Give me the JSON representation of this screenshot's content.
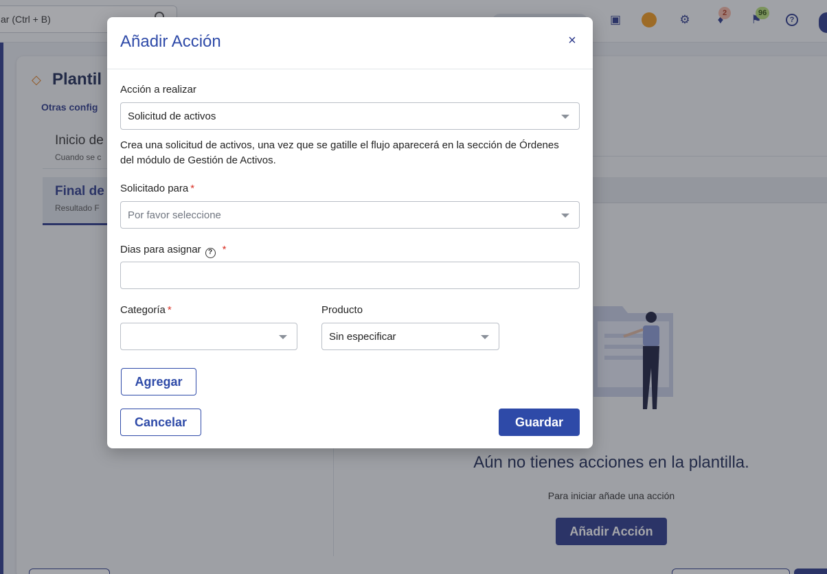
{
  "topbar": {
    "search_text": "ar (Ctrl + B)",
    "notifications_count": "2",
    "announcements_count": "96"
  },
  "background": {
    "page_title": "Plantil",
    "subnav": "Otras config",
    "stage1_title": "Inicio de",
    "stage1_sub": "Cuando se c",
    "stage2_title": "Final de",
    "stage2_sub": "Resultado F",
    "empty_title": "Aún no tienes acciones en la plantilla.",
    "empty_sub": "Para iniciar añade una acción",
    "add_button": "Añadir Acción"
  },
  "modal": {
    "title": "Añadir Acción",
    "action_label": "Acción a realizar",
    "action_value": "Solicitud de activos",
    "description": "Crea una solicitud de activos, una vez que se gatille el flujo aparecerá en la sección de Órdenes del módulo de Gestión de Activos.",
    "requested_for_label": "Solicitado para",
    "requested_for_placeholder": "Por favor seleccione",
    "days_label": "Dias para asignar",
    "days_value": "",
    "category_label": "Categoría",
    "category_value": "",
    "product_label": "Producto",
    "product_value": "Sin especificar",
    "required_mark": "*",
    "help_glyph": "?",
    "add_button": "Agregar",
    "cancel_button": "Cancelar",
    "save_button": "Guardar",
    "close_glyph": "×"
  },
  "colors": {
    "primary": "#2e4aa8",
    "required": "#d93025"
  }
}
